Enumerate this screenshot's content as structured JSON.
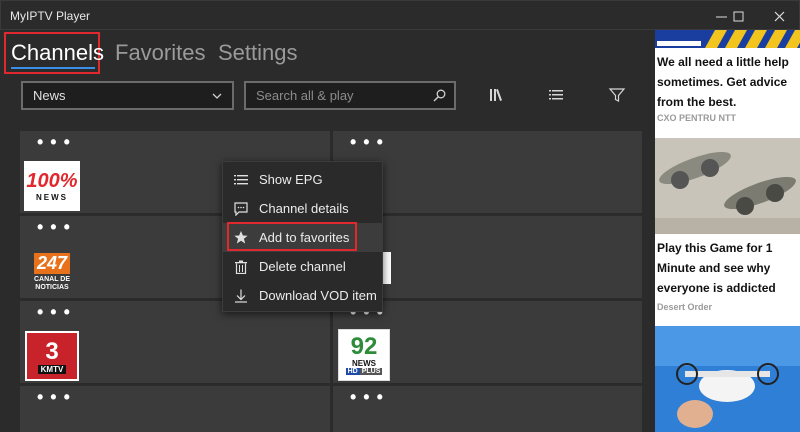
{
  "window": {
    "title": "MyIPTV Player"
  },
  "tabs": [
    {
      "label": "Channels"
    },
    {
      "label": "Favorites"
    },
    {
      "label": "Settings"
    }
  ],
  "toolbar": {
    "category_selected": "News",
    "search_placeholder": "Search all & play"
  },
  "channels": [
    {
      "menu": "• • •",
      "logo_main": "100%",
      "logo_sub": "NEWS"
    },
    {
      "menu": "• • •",
      "logo_main": "",
      "logo_sub": ""
    },
    {
      "menu": "• • •",
      "logo_main": "247",
      "logo_sub": "CANAL DE NOTICIAS"
    },
    {
      "menu": "• • •",
      "logo_main": "",
      "logo_sub": ""
    },
    {
      "menu": "• • •",
      "logo_main": "3",
      "logo_sub": "KMTV"
    },
    {
      "menu": "• • •",
      "logo_main": "92",
      "logo_sub": "NEWS",
      "logo_badge1": "HD",
      "logo_badge2": "PLUS"
    },
    {
      "menu": "• • •"
    },
    {
      "menu": "• • •"
    }
  ],
  "context_menu": [
    {
      "label": "Show EPG",
      "icon": "list-icon"
    },
    {
      "label": "Channel details",
      "icon": "comment-icon"
    },
    {
      "label": "Add to favorites",
      "icon": "star-icon"
    },
    {
      "label": "Delete channel",
      "icon": "trash-icon"
    },
    {
      "label": "Download VOD item",
      "icon": "download-icon"
    }
  ],
  "ads": [
    {
      "text": "We all need a little help sometimes. Get advice from the best.",
      "source": "CXO PENTRU NTT"
    },
    {
      "text": "Play this Game for 1 Minute and see why everyone is addicted",
      "source": "Desert Order"
    }
  ],
  "colors": {
    "accent": "#3a8ee6",
    "highlight": "#e0282e",
    "background": "#2b2b2b",
    "card": "#3b3b3b"
  }
}
